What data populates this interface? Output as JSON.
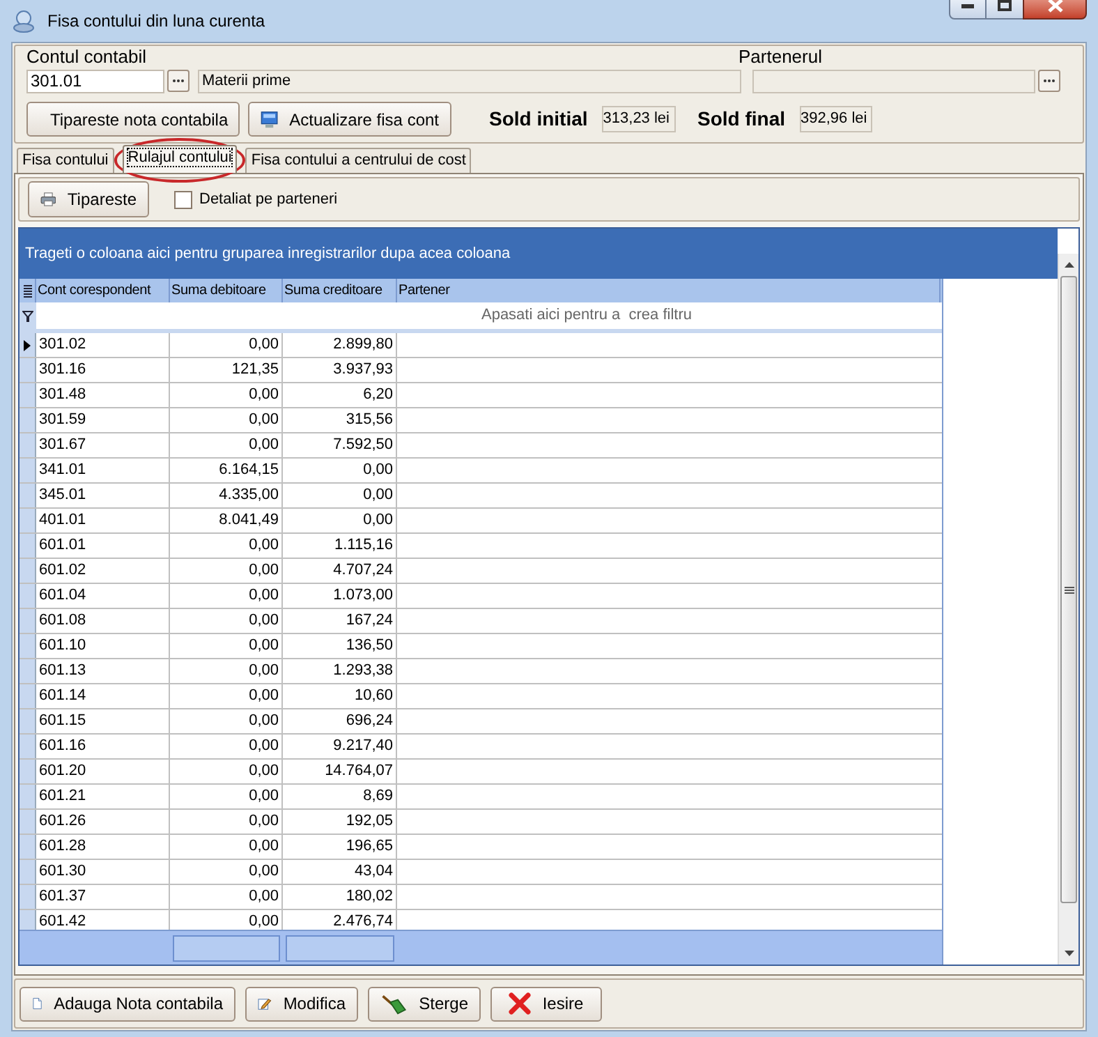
{
  "window": {
    "title": "Fisa contului din luna curenta"
  },
  "account": {
    "label": "Contul contabil",
    "code": "301.01",
    "name": "Materii prime"
  },
  "partner": {
    "label": "Partenerul"
  },
  "actions": [
    "Tipareste nota contabila",
    "Actualizare fisa cont"
  ],
  "balances": [
    {
      "label": "Sold initial",
      "value": "313,23 lei"
    },
    {
      "label": "Sold final",
      "value": "392,96 lei"
    }
  ],
  "tabs": [
    {
      "label": "Fisa contului",
      "selected": false,
      "circled": false
    },
    {
      "label": "Rulajul contului",
      "selected": true,
      "circled": true
    },
    {
      "label": "Fisa contului a centrului de cost",
      "selected": false,
      "circled": false
    }
  ],
  "toolbar": {
    "print": "Tipareste",
    "detail_checkbox": {
      "label": "Detaliat pe parteneri",
      "checked": false
    }
  },
  "grid": {
    "group_hint": "Trageti o coloana aici pentru gruparea inregistrarilor dupa acea coloana",
    "columns": [
      "Cont corespondent",
      "Suma debitoare",
      "Suma creditoare",
      "Partener"
    ],
    "filter_hint": "Apasati aici pentru a  crea filtru",
    "rows": [
      {
        "account": "301.02",
        "debit": "0,00",
        "credit": "2.899,80",
        "selected": true
      },
      {
        "account": "301.16",
        "debit": "121,35",
        "credit": "3.937,93",
        "selected": false
      },
      {
        "account": "301.48",
        "debit": "0,00",
        "credit": "6,20",
        "selected": false
      },
      {
        "account": "301.59",
        "debit": "0,00",
        "credit": "315,56",
        "selected": false
      },
      {
        "account": "301.67",
        "debit": "0,00",
        "credit": "7.592,50",
        "selected": false
      },
      {
        "account": "341.01",
        "debit": "6.164,15",
        "credit": "0,00",
        "selected": false
      },
      {
        "account": "345.01",
        "debit": "4.335,00",
        "credit": "0,00",
        "selected": false
      },
      {
        "account": "401.01",
        "debit": "8.041,49",
        "credit": "0,00",
        "selected": false
      },
      {
        "account": "601.01",
        "debit": "0,00",
        "credit": "1.115,16",
        "selected": false
      },
      {
        "account": "601.02",
        "debit": "0,00",
        "credit": "4.707,24",
        "selected": false
      },
      {
        "account": "601.04",
        "debit": "0,00",
        "credit": "1.073,00",
        "selected": false
      },
      {
        "account": "601.08",
        "debit": "0,00",
        "credit": "167,24",
        "selected": false
      },
      {
        "account": "601.10",
        "debit": "0,00",
        "credit": "136,50",
        "selected": false
      },
      {
        "account": "601.13",
        "debit": "0,00",
        "credit": "1.293,38",
        "selected": false
      },
      {
        "account": "601.14",
        "debit": "0,00",
        "credit": "10,60",
        "selected": false
      },
      {
        "account": "601.15",
        "debit": "0,00",
        "credit": "696,24",
        "selected": false
      },
      {
        "account": "601.16",
        "debit": "0,00",
        "credit": "9.217,40",
        "selected": false
      },
      {
        "account": "601.20",
        "debit": "0,00",
        "credit": "14.764,07",
        "selected": false
      },
      {
        "account": "601.21",
        "debit": "0,00",
        "credit": "8,69",
        "selected": false
      },
      {
        "account": "601.26",
        "debit": "0,00",
        "credit": "192,05",
        "selected": false
      },
      {
        "account": "601.28",
        "debit": "0,00",
        "credit": "196,65",
        "selected": false
      },
      {
        "account": "601.30",
        "debit": "0,00",
        "credit": "43,04",
        "selected": false
      },
      {
        "account": "601.37",
        "debit": "0,00",
        "credit": "180,02",
        "selected": false
      },
      {
        "account": "601.42",
        "debit": "0,00",
        "credit": "2.476,74",
        "selected": false
      }
    ]
  },
  "buttons": [
    {
      "label": "Adauga Nota contabila",
      "kind": "add"
    },
    {
      "label": "Modifica",
      "kind": "edit"
    },
    {
      "label": "Sterge",
      "kind": "delete"
    },
    {
      "label": "Iesire",
      "kind": "exit"
    }
  ]
}
